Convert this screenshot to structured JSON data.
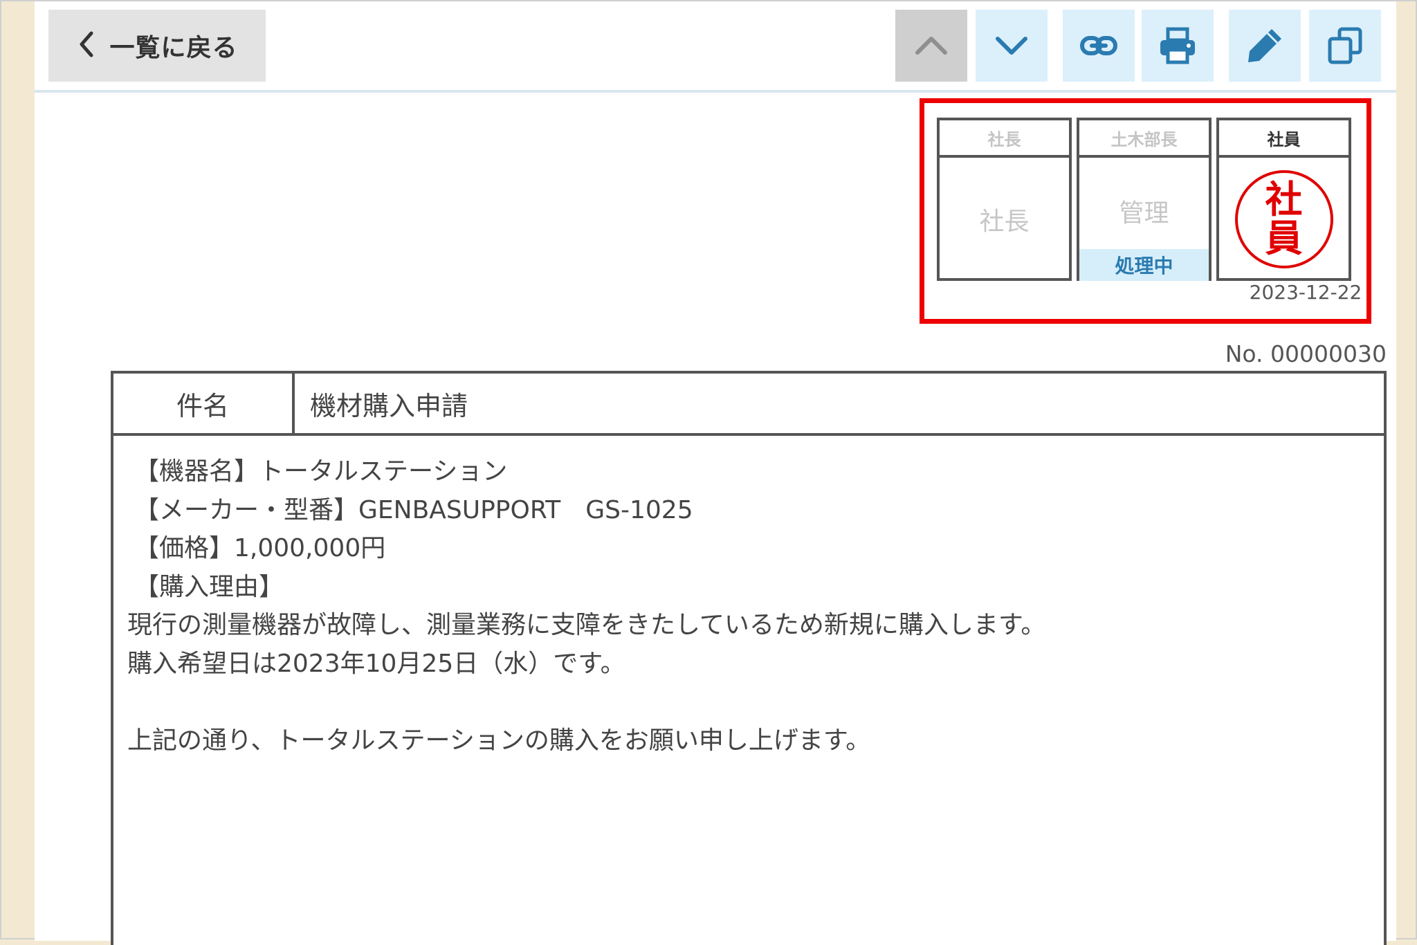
{
  "toolbar": {
    "back_label": "一覧に戻る",
    "buttons": [
      {
        "name": "prev-up-button",
        "icon": "chevron-up-icon",
        "disabled": true
      },
      {
        "name": "next-down-button",
        "icon": "chevron-down-icon",
        "disabled": false
      },
      {
        "name": "link-button",
        "icon": "link-icon",
        "disabled": false
      },
      {
        "name": "print-button",
        "icon": "printer-icon",
        "disabled": false
      },
      {
        "name": "edit-button",
        "icon": "pencil-icon",
        "disabled": false
      },
      {
        "name": "copy-button",
        "icon": "copy-icon",
        "disabled": false
      }
    ],
    "accent_color": "#2a7bb0"
  },
  "approval": {
    "highlight_color": "#ee0000",
    "stamps": [
      {
        "title": "社長",
        "name": "社長",
        "status": ""
      },
      {
        "title": "土木部長",
        "name": "管理",
        "status": "処理中"
      },
      {
        "title": "社員",
        "seal_text": [
          "社",
          "員"
        ],
        "date": "2023-12-22"
      }
    ]
  },
  "document": {
    "number": "No. 00000030",
    "subject_label": "件名",
    "subject_value": "機材購入申請",
    "body_lines": [
      "【機器名】トータルステーション",
      "【メーカー・型番】GENBASUPPORT　GS-1025",
      "【価格】1,000,000円",
      "【購入理由】",
      "現行の測量機器が故障し、測量業務に支障をきたしているため新規に購入します。",
      "購入希望日は2023年10月25日（水）です。",
      "",
      "上記の通り、トータルステーションの購入をお願い申し上げます。"
    ]
  }
}
